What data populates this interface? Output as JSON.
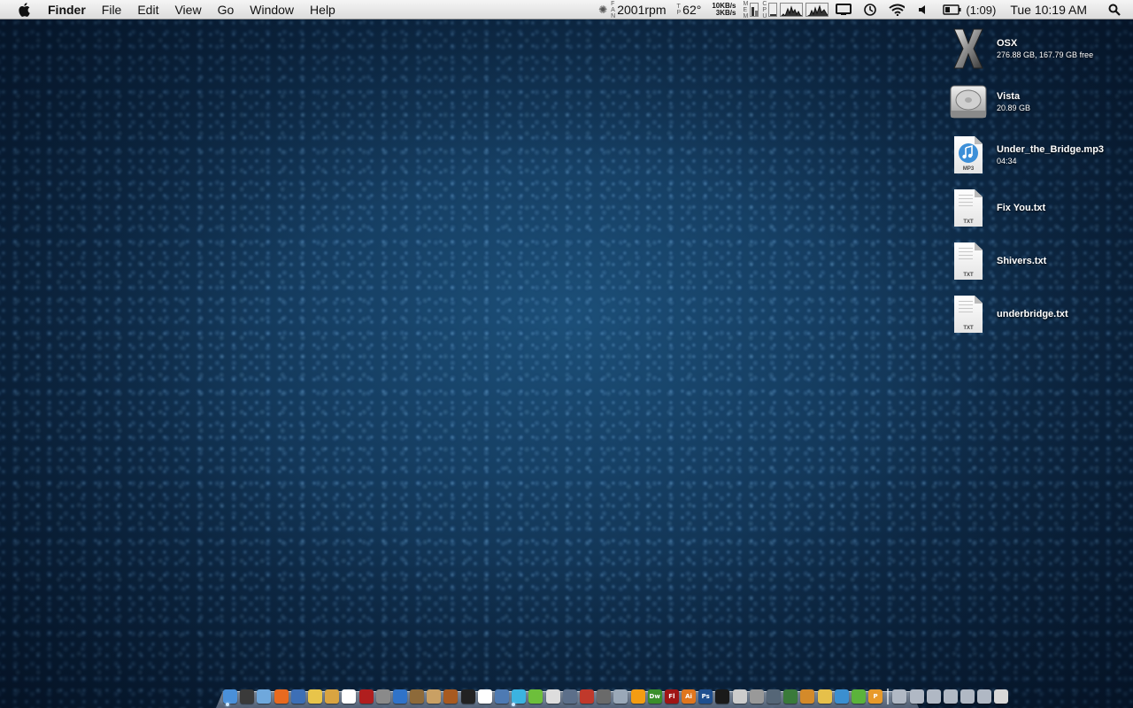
{
  "menubar": {
    "apple_icon": "apple-logo-icon",
    "app_name": "Finder",
    "menus": [
      "File",
      "Edit",
      "View",
      "Go",
      "Window",
      "Help"
    ],
    "fan": {
      "label_letters": [
        "F",
        "A",
        "N"
      ],
      "value": "2001rpm"
    },
    "temp": {
      "label_letters": [
        "T",
        "P"
      ],
      "value": "62°"
    },
    "network": {
      "down": "10KB/s",
      "up": "3KB/s"
    },
    "mem_label": [
      "M",
      "E",
      "M"
    ],
    "cpu_label": [
      "C",
      "P",
      "U"
    ],
    "battery": "(1:09)",
    "clock": "Tue 10:19 AM"
  },
  "desktop": {
    "items": [
      {
        "title": "OSX",
        "subtitle": "276.88 GB, 167.79 GB free",
        "icon": "osx-x-icon"
      },
      {
        "title": "Vista",
        "subtitle": "20.89 GB",
        "icon": "hard-drive-icon"
      },
      {
        "title": "Under_the_Bridge.mp3",
        "subtitle": "04:34",
        "icon": "mp3-file-icon",
        "ext": "MP3"
      },
      {
        "title": "Fix You.txt",
        "subtitle": "",
        "icon": "txt-file-icon",
        "ext": "TXT"
      },
      {
        "title": "Shivers.txt",
        "subtitle": "",
        "icon": "txt-file-icon",
        "ext": "TXT"
      },
      {
        "title": "underbridge.txt",
        "subtitle": "",
        "icon": "txt-file-icon",
        "ext": "TXT"
      }
    ]
  },
  "dock": {
    "apps": [
      {
        "name": "finder",
        "color": "#4a90d9",
        "label": ""
      },
      {
        "name": "dashboard",
        "color": "#3a3a3a",
        "label": ""
      },
      {
        "name": "mail",
        "color": "#6fa8dc",
        "label": ""
      },
      {
        "name": "firefox",
        "color": "#e86a1f",
        "label": ""
      },
      {
        "name": "adium",
        "color": "#3d6fb6",
        "label": ""
      },
      {
        "name": "stickies",
        "color": "#e8c44a",
        "label": ""
      },
      {
        "name": "pages",
        "color": "#d9a441",
        "label": ""
      },
      {
        "name": "calendar",
        "color": "#ffffff",
        "label": ""
      },
      {
        "name": "photo-booth",
        "color": "#b01e1e",
        "label": ""
      },
      {
        "name": "preview",
        "color": "#8a8a8a",
        "label": ""
      },
      {
        "name": "itunes",
        "color": "#2f73c9",
        "label": ""
      },
      {
        "name": "iphoto",
        "color": "#8d6a3a",
        "label": ""
      },
      {
        "name": "garageband",
        "color": "#c9a064",
        "label": ""
      },
      {
        "name": "guitar",
        "color": "#a85a20",
        "label": ""
      },
      {
        "name": "clapper",
        "color": "#222222",
        "label": ""
      },
      {
        "name": "textedit",
        "color": "#ffffff",
        "label": ""
      },
      {
        "name": "xcode",
        "color": "#4d7ab3",
        "label": ""
      },
      {
        "name": "messages",
        "color": "#3bb3e0",
        "label": ""
      },
      {
        "name": "growl",
        "color": "#6dbf3b",
        "label": ""
      },
      {
        "name": "chess",
        "color": "#dddddd",
        "label": ""
      },
      {
        "name": "spaces",
        "color": "#5c6f8a",
        "label": ""
      },
      {
        "name": "parallels",
        "color": "#c0392b",
        "label": ""
      },
      {
        "name": "vmware",
        "color": "#6a6a6a",
        "label": ""
      },
      {
        "name": "app-store",
        "color": "#9aa8b8",
        "label": ""
      },
      {
        "name": "vlc",
        "color": "#f39c12",
        "label": ""
      },
      {
        "name": "dreamweaver",
        "color": "#3a8f2b",
        "label": "Dw"
      },
      {
        "name": "flash",
        "color": "#a01515",
        "label": "Fl"
      },
      {
        "name": "illustrator",
        "color": "#e0761e",
        "label": "Ai"
      },
      {
        "name": "photoshop",
        "color": "#1f4f8f",
        "label": "Ps"
      },
      {
        "name": "terminal",
        "color": "#1a1a1a",
        "label": ""
      },
      {
        "name": "utility",
        "color": "#cccccc",
        "label": ""
      },
      {
        "name": "disk-utility",
        "color": "#999999",
        "label": ""
      },
      {
        "name": "pen-tool",
        "color": "#556677",
        "label": ""
      },
      {
        "name": "coda",
        "color": "#3a7a3a",
        "label": ""
      },
      {
        "name": "script-editor",
        "color": "#d48a2a",
        "label": ""
      },
      {
        "name": "cyberduck",
        "color": "#e6c04a",
        "label": ""
      },
      {
        "name": "transmit",
        "color": "#3b8fd0",
        "label": ""
      },
      {
        "name": "evernote",
        "color": "#5bb33b",
        "label": ""
      },
      {
        "name": "pixelmator",
        "color": "#e89a2a",
        "label": "P"
      }
    ],
    "stacks": [
      {
        "name": "stack-applications",
        "color": "#b0b8c4"
      },
      {
        "name": "stack-documents",
        "color": "#b0b8c4"
      },
      {
        "name": "stack-downloads",
        "color": "#b0b8c4"
      },
      {
        "name": "stack-pictures",
        "color": "#b0b8c4"
      },
      {
        "name": "stack-music",
        "color": "#b0b8c4"
      },
      {
        "name": "stack-folder",
        "color": "#b0b8c4"
      },
      {
        "name": "trash",
        "color": "#d8d8d8"
      }
    ]
  }
}
